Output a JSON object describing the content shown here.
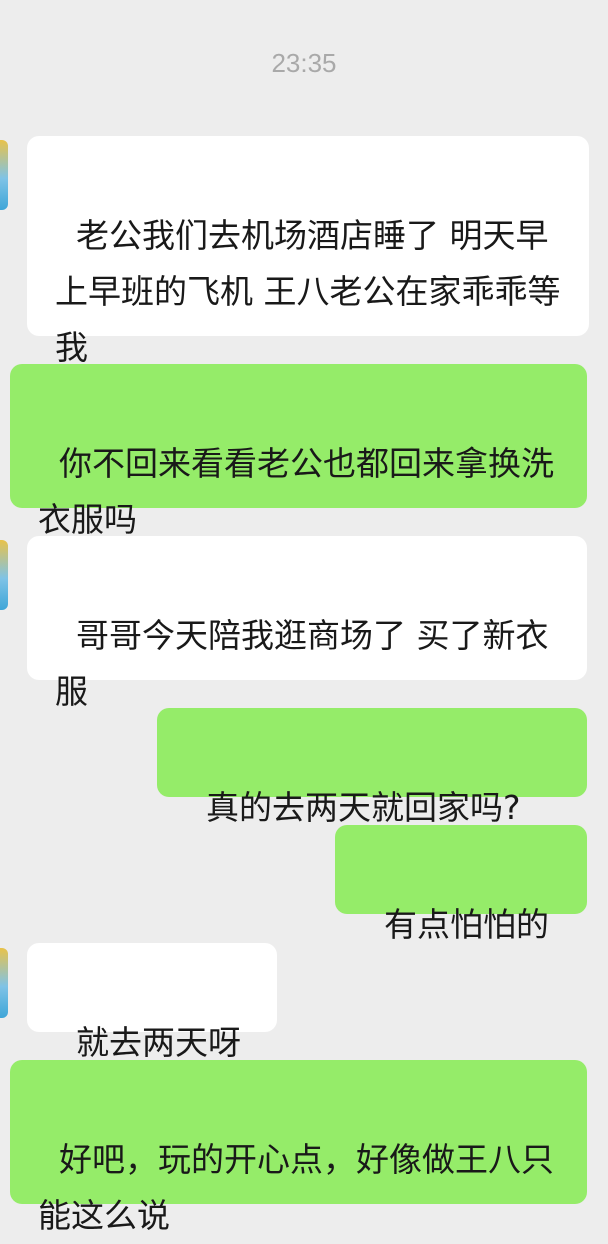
{
  "timestamp": "23:35",
  "messages": [
    {
      "side": "left",
      "text": "老公我们去机场酒店睡了 明天早上早班的飞机 王八老公在家乖乖等我"
    },
    {
      "side": "right",
      "text": "你不回来看看老公也都回来拿换洗衣服吗"
    },
    {
      "side": "left",
      "text": "哥哥今天陪我逛商场了 买了新衣服"
    },
    {
      "side": "right",
      "text": "真的去两天就回家吗?"
    },
    {
      "side": "right",
      "text": "有点怕怕的"
    },
    {
      "side": "left",
      "text": "就去两天呀"
    },
    {
      "side": "right",
      "text": "好吧，玩的开心点，好像做王八只能这么说"
    }
  ],
  "colors": {
    "background": "#ededed",
    "incoming_bubble": "#ffffff",
    "outgoing_bubble": "#95ec69",
    "timestamp_text": "#a9a9a9"
  }
}
